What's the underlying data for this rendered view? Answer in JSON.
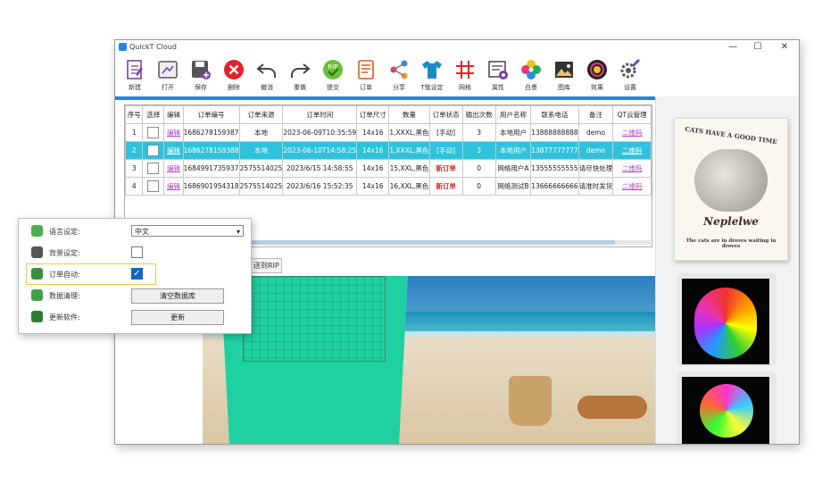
{
  "window": {
    "title": "QuickT Cloud",
    "controls": {
      "minimize": "—",
      "maximize": "☐",
      "close": "✕"
    }
  },
  "toolbar": [
    {
      "label": "新建",
      "icon": "new-doc-icon"
    },
    {
      "label": "打开",
      "icon": "open-icon"
    },
    {
      "label": "保存",
      "icon": "save-icon"
    },
    {
      "label": "删除",
      "icon": "delete-icon"
    },
    {
      "label": "撤消",
      "icon": "undo-icon"
    },
    {
      "label": "重做",
      "icon": "redo-icon"
    },
    {
      "label": "提交",
      "icon": "rip-icon"
    },
    {
      "label": "订单",
      "icon": "order-icon"
    },
    {
      "label": "分享",
      "icon": "share-icon"
    },
    {
      "label": "T恤设定",
      "icon": "tshirt-icon"
    },
    {
      "label": "网格",
      "icon": "grid-icon"
    },
    {
      "label": "属性",
      "icon": "properties-icon"
    },
    {
      "label": "白墨",
      "icon": "white-ink-icon"
    },
    {
      "label": "图库",
      "icon": "gallery-icon"
    },
    {
      "label": "效果",
      "icon": "effect-icon"
    },
    {
      "label": "设置",
      "icon": "settings-icon"
    }
  ],
  "toolbar_colors": {
    "accent": "#1e88e5",
    "selected_row": "#2fc2dd",
    "link": "#b43cc8",
    "new_order": "#e02020",
    "shirt": "#1fd1a1"
  },
  "table": {
    "headers": [
      "序号",
      "选择",
      "编辑",
      "订单编号",
      "订单来源",
      "订单时间",
      "订单尺寸",
      "数量",
      "订单状态",
      "输出次数",
      "用户名称",
      "联系电话",
      "备注",
      "QT云管理"
    ],
    "rows": [
      {
        "idx": "1",
        "edit": "编辑",
        "order_no": "1686278159387",
        "source": "本地",
        "time": "2023-06-09T10:35:59",
        "size": "14x16",
        "qty": "1,XXXL,黑色",
        "status": "[手动]",
        "outputs": "3",
        "user": "本地用户",
        "phone": "13888888888",
        "note": "demo",
        "qt": "二维码"
      },
      {
        "idx": "2",
        "edit": "编辑",
        "order_no": "1686278159388",
        "source": "本地",
        "time": "2023-06-10T14:58:25",
        "size": "14x16",
        "qty": "1,XXXL,黑色",
        "status": "[手动]",
        "outputs": "3",
        "user": "本地用户",
        "phone": "13877777777",
        "note": "demo",
        "qt": "二维码"
      },
      {
        "idx": "3",
        "edit": "编辑",
        "order_no": "1684991735937",
        "source": "2575514025",
        "time": "2023/6/15 14:58:55",
        "size": "14x16",
        "qty": "15,XXL,黑色",
        "status": "新订单",
        "outputs": "0",
        "user": "网络用户A",
        "phone": "13555555555",
        "note": "请尽快处理",
        "qt": "二维码"
      },
      {
        "idx": "4",
        "edit": "编辑",
        "order_no": "1686901954318",
        "source": "2575514025",
        "time": "2023/6/16 15:52:35",
        "size": "14x16",
        "qty": "16,XXL,黑色",
        "status": "新订单",
        "outputs": "0",
        "user": "网络测试B",
        "phone": "13666666666",
        "note": "请准时发货",
        "qt": "二维码"
      }
    ]
  },
  "rip_button": "送到RIP",
  "design": {
    "title_arc": "CATS HAVE A GOOD TIME",
    "brand": "Neplelwe",
    "footer": "The cats are in droves waiting in droves"
  },
  "settings": {
    "language_label": "语言设定:",
    "language_value": "中文",
    "background_label": "背景设定:",
    "background_checked": false,
    "auto_order_label": "订单自动:",
    "auto_order_checked": true,
    "data_clean_label": "数据清理:",
    "data_clean_button": "清空数据库",
    "update_label": "更新软件:",
    "update_button": "更新"
  }
}
